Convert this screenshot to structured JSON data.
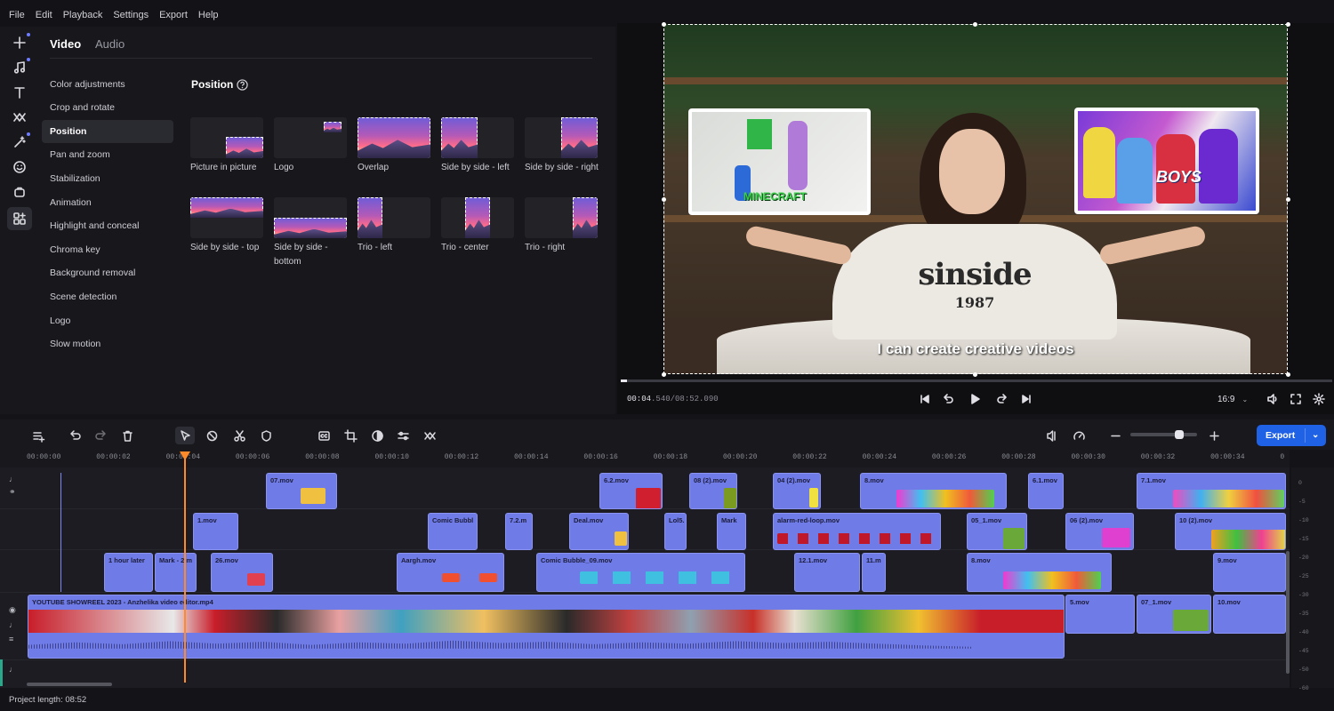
{
  "menu": [
    "File",
    "Edit",
    "Playback",
    "Settings",
    "Export",
    "Help"
  ],
  "panel": {
    "tabs": [
      "Video",
      "Audio"
    ],
    "sidebar": [
      "Color adjustments",
      "Crop and rotate",
      "Position",
      "Pan and zoom",
      "Stabilization",
      "Animation",
      "Highlight and conceal",
      "Chroma key",
      "Background removal",
      "Scene detection",
      "Logo",
      "Slow motion"
    ],
    "active_item": "Position",
    "section_title": "Position",
    "presets": [
      "Picture in picture",
      "Logo",
      "Overlap",
      "Side by side - left",
      "Side by side - right",
      "Side by side - top",
      "Side by side - bottom",
      "Trio - left",
      "Trio - center",
      "Trio - right"
    ]
  },
  "preview": {
    "caption": "I can create creative videos",
    "sweatshirt_text": "sinside",
    "sweatshirt_year": "1987",
    "left_sign": "MINECRAFT",
    "right_sign": "BOYS",
    "time_current": "00:04",
    "time_frac": ".540",
    "time_total": "/08:52.090",
    "aspect": "16:9",
    "progress_fraction": 0.009
  },
  "toolbar": {
    "export_label": "Export"
  },
  "timeline": {
    "ticks": [
      "00:00:00",
      "00:00:02",
      "00:00:04",
      "00:00:06",
      "00:00:08",
      "00:00:10",
      "00:00:12",
      "00:00:14",
      "00:00:16",
      "00:00:18",
      "00:00:20",
      "00:00:22",
      "00:00:24",
      "00:00:26",
      "00:00:28",
      "00:00:30",
      "00:00:32",
      "00:00:34",
      "0"
    ],
    "clips": {
      "c07": "07.mov",
      "c62": "6.2.mov",
      "c082": "08 (2).mov",
      "c042": "04 (2).mov",
      "c8": "8.mov",
      "c61": "6.1.mov",
      "c71": "7.1.mov",
      "c1": "1.mov",
      "ccb": "Comic Bubbl",
      "c72": "7.2.m",
      "cdeal": "Deal.mov",
      "clol": "Lol5.",
      "cmark2": "Mark",
      "calarm": "alarm-red-loop.mov",
      "c051": "05_1.mov",
      "c062": "06 (2).mov",
      "c102": "10 (2).mov",
      "c1h": "1 hour later",
      "cmark": "Mark - 2.m",
      "c26": "26.mov",
      "caargh": "Aargh.mov",
      "ccb09": "Comic Bubble_09.mov",
      "c121": "12.1.mov",
      "c11": "11.m",
      "c8b": "8.mov",
      "c9": "9.mov",
      "cmain": "YOUTUBE SHOWREEL 2023 - Anzhelika video editor.mp4",
      "c5": "5.mov",
      "c071": "07_1.mov",
      "c10": "10.mov"
    },
    "meter": [
      "0",
      "-5",
      "-10",
      "-15",
      "-20",
      "-25",
      "-30",
      "-35",
      "-40",
      "-45",
      "-50",
      "-60"
    ]
  },
  "status": {
    "project_length": "Project length: 08:52"
  }
}
